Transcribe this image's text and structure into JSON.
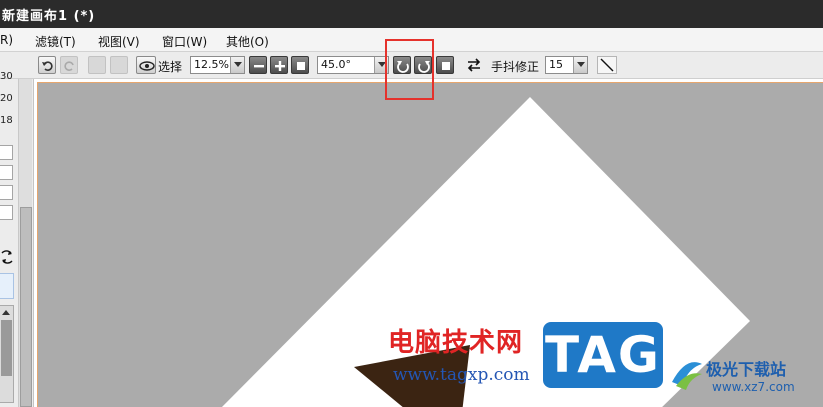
{
  "window": {
    "title": "新建画布1 (*)"
  },
  "menu": [
    {
      "label": "R)"
    },
    {
      "label": "滤镜(T)"
    },
    {
      "label": "视图(V)"
    },
    {
      "label": "窗口(W)"
    },
    {
      "label": "其他(O)"
    }
  ],
  "toolbar": {
    "select_label": "选择",
    "zoom_value": "12.5%",
    "angle_value": "45.0°",
    "stabilizer_label": "手抖修正",
    "stabilizer_value": "15"
  },
  "left_panel": {
    "numbers": [
      "30",
      "20",
      "18"
    ]
  },
  "watermarks": {
    "site_cn": "电脑技术网",
    "site_url": "www.tagxp.com",
    "tag": "TAG",
    "site2_cn": "极光下载站",
    "site2_url": "www.xz7.com"
  },
  "colors": {
    "canvas_bg": "#ababab",
    "paper": "#ffffff",
    "highlight": "#e5322c",
    "shape": "#3b2412"
  }
}
